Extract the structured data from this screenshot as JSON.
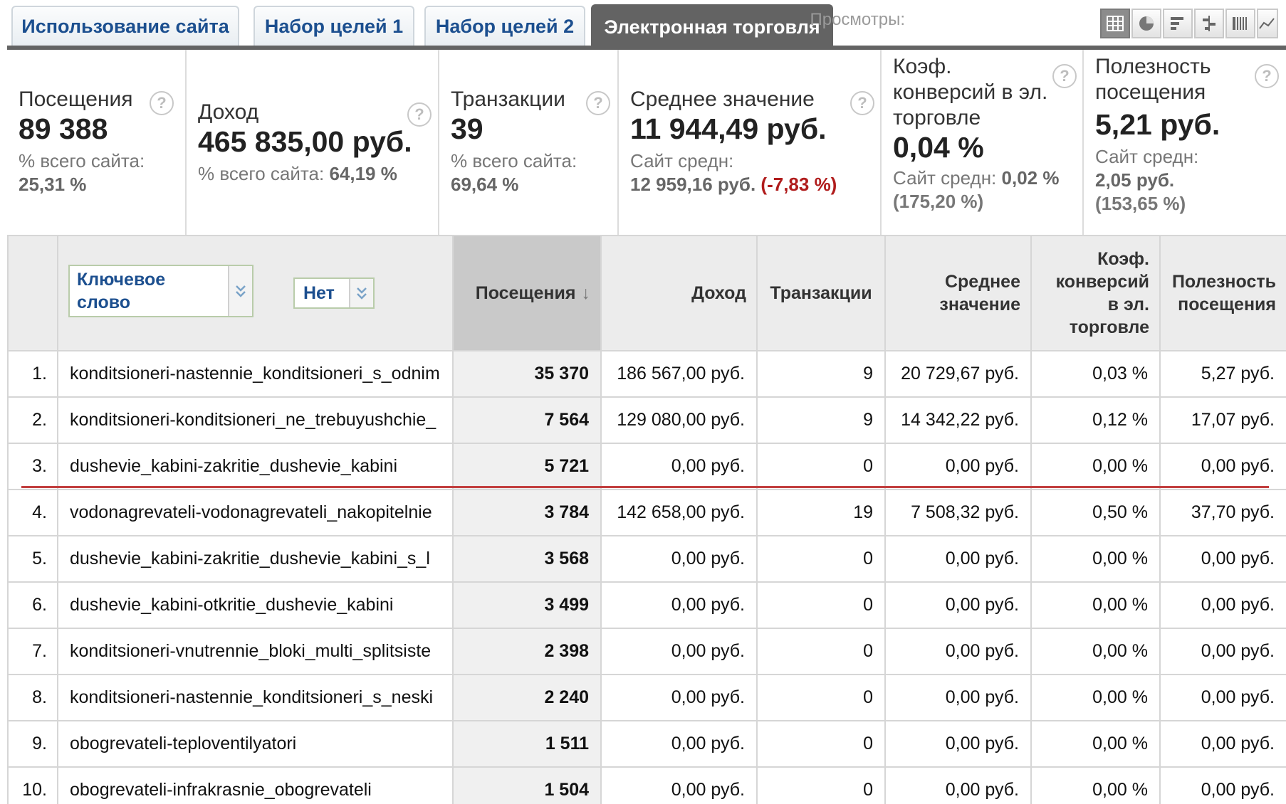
{
  "tabs": [
    {
      "label": "Использование сайта",
      "active": false
    },
    {
      "label": "Набор целей 1",
      "active": false
    },
    {
      "label": "Набор целей 2",
      "active": false
    },
    {
      "label": "Электронная торговля",
      "active": true
    }
  ],
  "views": {
    "label": "Просмотры:",
    "buttons": [
      "table-view-icon",
      "pie-chart-icon",
      "bar-chart-icon",
      "comparison-icon",
      "pivot-icon",
      "trend-icon"
    ]
  },
  "summary": {
    "visits": {
      "label": "Посещения",
      "value": "89 388",
      "sub_label": "% всего сайта:",
      "sub_value": "25,31 %"
    },
    "revenue": {
      "label": "Доход",
      "value": "465 835,00 руб.",
      "sub_label": "% всего сайта:",
      "sub_value": "64,19 %"
    },
    "transactions": {
      "label": "Транзакции",
      "value": "39",
      "sub_label": "% всего сайта:",
      "sub_value": "69,64 %"
    },
    "avg_value": {
      "label": "Среднее значение",
      "value": "11 944,49 руб.",
      "sub_label": "Сайт средн:",
      "sub_value": "12 959,16 руб.",
      "delta": "(-7,83 %)"
    },
    "conversion": {
      "label_1": "Коэф.",
      "label_2": "конверсий в эл.",
      "label_3": "торговле",
      "value": "0,04 %",
      "sub_label": "Сайт средн:",
      "sub_value": "0,02 %",
      "delta": "(175,20 %)"
    },
    "per_visit": {
      "label_1": "Полезность",
      "label_2": "посещения",
      "value": "5,21 руб.",
      "sub_label": "Сайт средн:",
      "sub_value": "2,05 руб.",
      "delta": "(153,65 %)"
    }
  },
  "help_symbol": "?",
  "table": {
    "dimension_dropdown": {
      "line1": "Ключевое",
      "line2": "слово"
    },
    "secondary_dropdown": "Нет",
    "headers": {
      "visits": "Посещения",
      "sort_arrow": "↓",
      "revenue": "Доход",
      "transactions": "Транзакции",
      "avg_value_1": "Среднее",
      "avg_value_2": "значение",
      "conv_1": "Коэф.",
      "conv_2": "конверсий",
      "conv_3": "в эл.",
      "conv_4": "торговле",
      "per_visit_1": "Полезность",
      "per_visit_2": "посещения"
    },
    "rows": [
      {
        "n": "1.",
        "keyword": "konditsioneri-nastennie_konditsioneri_s_odnim",
        "visits": "35 370",
        "revenue": "186 567,00 руб.",
        "transactions": "9",
        "avg": "20 729,67 руб.",
        "conv": "0,03 %",
        "per_visit": "5,27 руб."
      },
      {
        "n": "2.",
        "keyword": "konditsioneri-konditsioneri_ne_trebuyushchie_",
        "visits": "7 564",
        "revenue": "129 080,00 руб.",
        "transactions": "9",
        "avg": "14 342,22 руб.",
        "conv": "0,12 %",
        "per_visit": "17,07 руб."
      },
      {
        "n": "3.",
        "keyword": "dushevie_kabini-zakritie_dushevie_kabini",
        "visits": "5 721",
        "revenue": "0,00 руб.",
        "transactions": "0",
        "avg": "0,00 руб.",
        "conv": "0,00 %",
        "per_visit": "0,00 руб."
      },
      {
        "n": "4.",
        "keyword": "vodonagrevateli-vodonagrevateli_nakopitelnie",
        "visits": "3 784",
        "revenue": "142 658,00 руб.",
        "transactions": "19",
        "avg": "7 508,32 руб.",
        "conv": "0,50 %",
        "per_visit": "37,70 руб."
      },
      {
        "n": "5.",
        "keyword": "dushevie_kabini-zakritie_dushevie_kabini_s_l",
        "visits": "3 568",
        "revenue": "0,00 руб.",
        "transactions": "0",
        "avg": "0,00 руб.",
        "conv": "0,00 %",
        "per_visit": "0,00 руб."
      },
      {
        "n": "6.",
        "keyword": "dushevie_kabini-otkritie_dushevie_kabini",
        "visits": "3 499",
        "revenue": "0,00 руб.",
        "transactions": "0",
        "avg": "0,00 руб.",
        "conv": "0,00 %",
        "per_visit": "0,00 руб."
      },
      {
        "n": "7.",
        "keyword": "konditsioneri-vnutrennie_bloki_multi_splitsiste",
        "visits": "2 398",
        "revenue": "0,00 руб.",
        "transactions": "0",
        "avg": "0,00 руб.",
        "conv": "0,00 %",
        "per_visit": "0,00 руб."
      },
      {
        "n": "8.",
        "keyword": "konditsioneri-nastennie_konditsioneri_s_neski",
        "visits": "2 240",
        "revenue": "0,00 руб.",
        "transactions": "0",
        "avg": "0,00 руб.",
        "conv": "0,00 %",
        "per_visit": "0,00 руб."
      },
      {
        "n": "9.",
        "keyword": "obogrevateli-teploventilyatori",
        "visits": "1 511",
        "revenue": "0,00 руб.",
        "transactions": "0",
        "avg": "0,00 руб.",
        "conv": "0,00 %",
        "per_visit": "0,00 руб."
      },
      {
        "n": "10.",
        "keyword": "obogrevateli-infrakrasnie_obogrevateli",
        "visits": "1 504",
        "revenue": "0,00 руб.",
        "transactions": "0",
        "avg": "0,00 руб.",
        "conv": "0,00 %",
        "per_visit": "0,00 руб."
      }
    ]
  },
  "colors": {
    "negative": "#b01c1c",
    "positive": "#2a8a1a",
    "link": "#1c4f8f",
    "active_tab": "#636363",
    "annotation_line": "#c24040"
  }
}
